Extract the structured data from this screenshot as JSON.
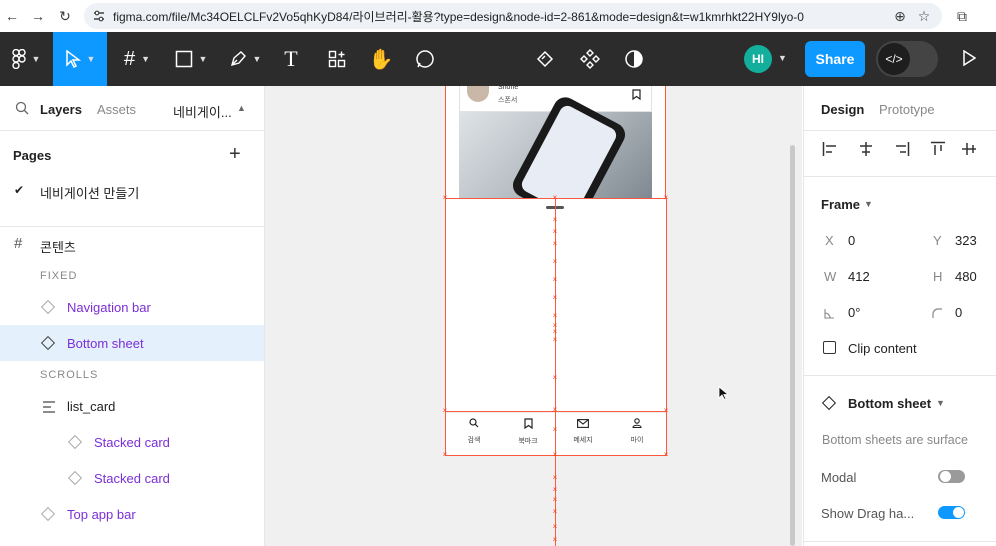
{
  "browser": {
    "url": "figma.com/file/Mc34OELCLFv2Vo5qhKyD84/라이브러리-활용?type=design&node-id=2-861&mode=design&t=w1kmrhkt22HY9lyo-0"
  },
  "toolbar": {
    "avatar_initials": "HI",
    "share_label": "Share"
  },
  "left_panel": {
    "tabs": {
      "layers": "Layers",
      "assets": "Assets",
      "page_dropdown": "네비게이..."
    },
    "pages_title": "Pages",
    "current_page": "네비게이션 만들기",
    "frame_name": "콘텐츠",
    "section_fixed": "FIXED",
    "section_scrolls": "SCROLLS",
    "layers": [
      {
        "label": "Navigation bar"
      },
      {
        "label": "Bottom sheet"
      },
      {
        "label": "list_card"
      },
      {
        "label": "Stacked card"
      },
      {
        "label": "Stacked card"
      },
      {
        "label": "Top app bar"
      }
    ]
  },
  "canvas": {
    "card_name": "Shone",
    "card_sub": "스폰서",
    "bottom_nav": [
      {
        "icon": "search-icon",
        "label": "검색"
      },
      {
        "icon": "bookmark-icon",
        "label": "북마크"
      },
      {
        "icon": "mail-icon",
        "label": "메세지"
      },
      {
        "icon": "person-icon",
        "label": "마이"
      }
    ]
  },
  "right_panel": {
    "tabs": {
      "design": "Design",
      "prototype": "Prototype"
    },
    "frame_section": "Frame",
    "x_label": "X",
    "x_value": "0",
    "y_label": "Y",
    "y_value": "323",
    "w_label": "W",
    "w_value": "412",
    "h_label": "H",
    "h_value": "480",
    "rotation_value": "0°",
    "radius_value": "0",
    "clip_content": "Clip content",
    "component_name": "Bottom sheet",
    "component_desc": "Bottom sheets are surface",
    "modal_label": "Modal",
    "modal_on": false,
    "drag_label": "Show Drag ha...",
    "drag_on": true
  },
  "colors": {
    "accent": "#0d99ff",
    "toolbar": "#2c2c2c",
    "guide": "#ff5a3c",
    "component": "#7b2fd6"
  }
}
